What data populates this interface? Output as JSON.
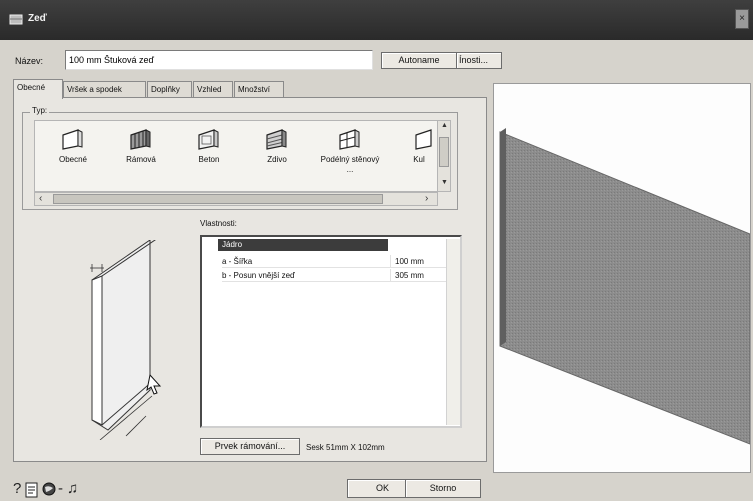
{
  "window": {
    "title": "Zeď",
    "close_glyph": "×"
  },
  "name_row": {
    "label": "Název:",
    "value": "100 mm Štuková zeď",
    "autoname_label": "Autoname",
    "options_label": "Ínosti..."
  },
  "tabs": [
    {
      "label": "Obecné",
      "active": true
    },
    {
      "label": "Vršek a spodek",
      "active": false
    },
    {
      "label": "Doplňky",
      "active": false
    },
    {
      "label": "Vzhled",
      "active": false
    },
    {
      "label": "Množství",
      "active": false
    }
  ],
  "type_group": {
    "label": "Typ:",
    "items": [
      {
        "label": "Obecné",
        "icon": "generic-wall-icon"
      },
      {
        "label": "Rámová",
        "icon": "frame-wall-icon"
      },
      {
        "label": "Beton",
        "icon": "concrete-wall-icon"
      },
      {
        "label": "Zdivo",
        "icon": "masonry-wall-icon"
      },
      {
        "label": "Podélný stěnový ...",
        "icon": "longitudinal-wall-icon"
      },
      {
        "label": "Kul",
        "icon": "partial-wall-icon"
      }
    ]
  },
  "properties": {
    "label": "Vlastnosti:",
    "header": "Jádro",
    "expander_glyph": "−",
    "rows": [
      {
        "name": "a - Šířka",
        "value": "100 mm"
      },
      {
        "name": "b - Posun vnější zeď",
        "value": "305 mm"
      }
    ]
  },
  "frame": {
    "button_label": "Prvek rámování...",
    "size_text": "Sesk 51mm X 102mm"
  },
  "bottom_icons": [
    "help-icon",
    "document-icon",
    "globe-icon",
    "separator-icon",
    "music-note-icon"
  ],
  "bottom_glyphs": {
    "help": "?",
    "separator": "-",
    "music": "♫"
  },
  "buttons": {
    "ok_label": "OK",
    "cancel_label": "Storno"
  },
  "colors": {
    "titlebar": "#333333",
    "wall_face": "#8c8c8c",
    "wall_side": "#5f5f5f",
    "selection": "#3c3c3c"
  },
  "scroll_glyphs": {
    "left": "‹",
    "right": "›",
    "up": "▲",
    "down": "▼"
  }
}
